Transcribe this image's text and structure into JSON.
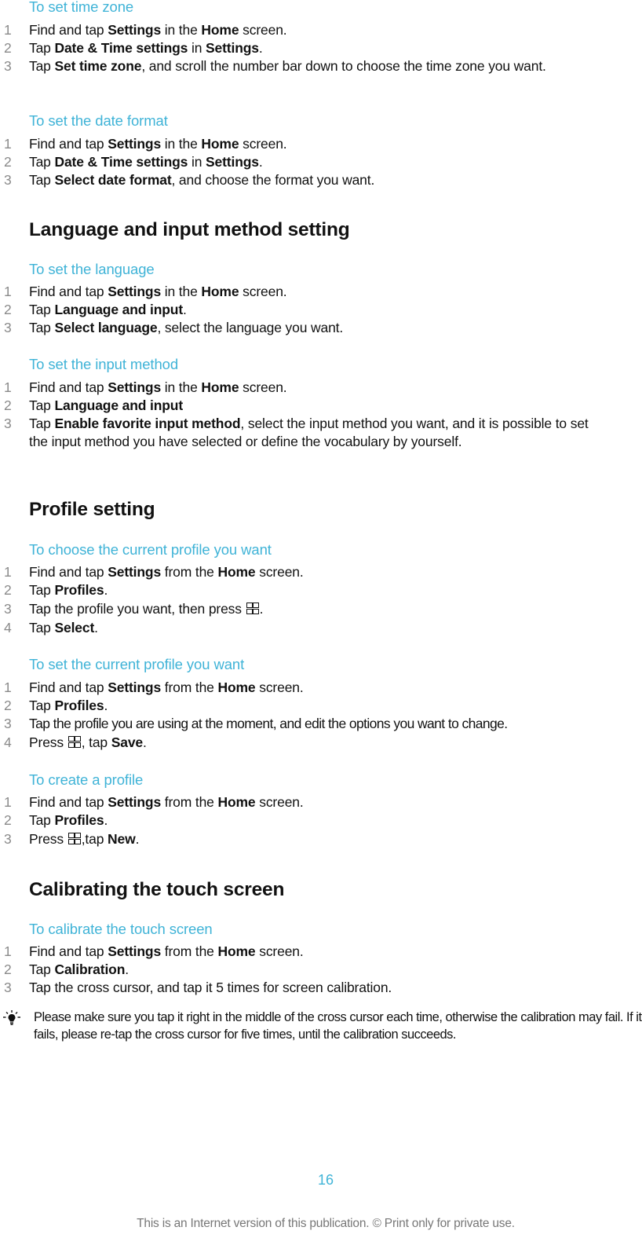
{
  "sections": [
    {
      "id": "time-zone",
      "subheading": "To set time zone",
      "steps": [
        {
          "num": "1",
          "parts": [
            [
              "t",
              "Find and tap "
            ],
            [
              "b",
              "Settings"
            ],
            [
              "t",
              " in the "
            ],
            [
              "b",
              "Home"
            ],
            [
              "t",
              " screen."
            ]
          ]
        },
        {
          "num": "2",
          "parts": [
            [
              "t",
              "Tap "
            ],
            [
              "b",
              "Date & Time settings"
            ],
            [
              "t",
              " in "
            ],
            [
              "b",
              "Settings"
            ],
            [
              "t",
              "."
            ]
          ]
        },
        {
          "num": "3",
          "parts": [
            [
              "t",
              "Tap "
            ],
            [
              "b",
              "Set time zone"
            ],
            [
              "t",
              ", and scroll the number bar down to choose the time zone you want."
            ]
          ]
        }
      ]
    },
    {
      "id": "date-format",
      "subheading": "To set the date format",
      "steps": [
        {
          "num": "1",
          "parts": [
            [
              "t",
              "Find and tap "
            ],
            [
              "b",
              "Settings"
            ],
            [
              "t",
              " in the "
            ],
            [
              "b",
              "Home"
            ],
            [
              "t",
              " screen."
            ]
          ]
        },
        {
          "num": "2",
          "parts": [
            [
              "t",
              "Tap "
            ],
            [
              "b",
              "Date & Time settings"
            ],
            [
              "t",
              " in "
            ],
            [
              "b",
              "Settings"
            ],
            [
              "t",
              "."
            ]
          ]
        },
        {
          "num": "3",
          "parts": [
            [
              "t",
              "Tap "
            ],
            [
              "b",
              "Select date format"
            ],
            [
              "t",
              ", and choose the format you want."
            ]
          ]
        }
      ]
    },
    {
      "id": "language",
      "heading": "Language and input method setting",
      "subheading": "To set the language",
      "steps": [
        {
          "num": "1",
          "parts": [
            [
              "t",
              "Find and tap "
            ],
            [
              "b",
              "Settings"
            ],
            [
              "t",
              " in the "
            ],
            [
              "b",
              "Home"
            ],
            [
              "t",
              " screen."
            ]
          ]
        },
        {
          "num": "2",
          "parts": [
            [
              "t",
              "Tap "
            ],
            [
              "b",
              "Language and input"
            ],
            [
              "t",
              "."
            ]
          ]
        },
        {
          "num": "3",
          "parts": [
            [
              "t",
              "Tap "
            ],
            [
              "b",
              "Select language"
            ],
            [
              "t",
              ", select the language you want."
            ]
          ]
        }
      ]
    },
    {
      "id": "input-method",
      "subheading": "To set the input method",
      "steps": [
        {
          "num": "1",
          "parts": [
            [
              "t",
              "Find and tap "
            ],
            [
              "b",
              "Settings"
            ],
            [
              "t",
              " in the "
            ],
            [
              "b",
              "Home"
            ],
            [
              "t",
              " screen."
            ]
          ]
        },
        {
          "num": "2",
          "parts": [
            [
              "t",
              "Tap "
            ],
            [
              "b",
              "Language and input"
            ]
          ]
        },
        {
          "num": "3",
          "parts": [
            [
              "t",
              "Tap "
            ],
            [
              "b",
              "Enable favorite input method"
            ],
            [
              "t",
              ", select the input method you want, and it is possible to set the input method you have selected or define the vocabulary by yourself."
            ]
          ]
        }
      ]
    },
    {
      "id": "choose-profile",
      "heading": "Profile setting",
      "subheading": "To choose the current profile you want",
      "steps": [
        {
          "num": "1",
          "parts": [
            [
              "t",
              "Find and tap "
            ],
            [
              "b",
              "Settings"
            ],
            [
              "t",
              " from the "
            ],
            [
              "b",
              "Home"
            ],
            [
              "t",
              " screen."
            ]
          ]
        },
        {
          "num": "2",
          "parts": [
            [
              "t",
              "Tap "
            ],
            [
              "b",
              "Profiles"
            ],
            [
              "t",
              "."
            ]
          ]
        },
        {
          "num": "3",
          "parts": [
            [
              "t",
              "Tap the profile you want, then press "
            ],
            [
              "i",
              "menu-icon"
            ],
            [
              "t",
              "."
            ]
          ]
        },
        {
          "num": "4",
          "parts": [
            [
              "t",
              "Tap "
            ],
            [
              "b",
              "Select"
            ],
            [
              "t",
              "."
            ]
          ]
        }
      ]
    },
    {
      "id": "set-profile",
      "subheading": "To set the current profile you want",
      "steps": [
        {
          "num": "1",
          "parts": [
            [
              "t",
              "Find and tap "
            ],
            [
              "b",
              "Settings"
            ],
            [
              "t",
              " from the "
            ],
            [
              "b",
              "Home"
            ],
            [
              "t",
              " screen."
            ]
          ]
        },
        {
          "num": "2",
          "parts": [
            [
              "t",
              "Tap "
            ],
            [
              "b",
              "Profiles"
            ],
            [
              "t",
              "."
            ]
          ]
        },
        {
          "num": "3",
          "tight": true,
          "parts": [
            [
              "t",
              "Tap the profile you are using at the moment, and edit the options you want to change."
            ]
          ]
        },
        {
          "num": "4",
          "parts": [
            [
              "t",
              "Press "
            ],
            [
              "i",
              "menu-icon"
            ],
            [
              "t",
              ", tap "
            ],
            [
              "b",
              "Save"
            ],
            [
              "t",
              "."
            ]
          ]
        }
      ]
    },
    {
      "id": "create-profile",
      "subheading": "To create a profile",
      "steps": [
        {
          "num": "1",
          "parts": [
            [
              "t",
              "Find and tap "
            ],
            [
              "b",
              "Settings"
            ],
            [
              "t",
              " from the "
            ],
            [
              "b",
              "Home"
            ],
            [
              "t",
              " screen."
            ]
          ]
        },
        {
          "num": "2",
          "parts": [
            [
              "t",
              "Tap "
            ],
            [
              "b",
              "Profiles"
            ],
            [
              "t",
              "."
            ]
          ]
        },
        {
          "num": "3",
          "parts": [
            [
              "t",
              "Press "
            ],
            [
              "i",
              "menu-icon"
            ],
            [
              "t",
              ",tap "
            ],
            [
              "b",
              "New"
            ],
            [
              "t",
              "."
            ]
          ]
        }
      ]
    },
    {
      "id": "calibrate",
      "heading": "Calibrating the touch screen",
      "subheading": "To calibrate the touch screen",
      "steps": [
        {
          "num": "1",
          "parts": [
            [
              "t",
              "Find and tap "
            ],
            [
              "b",
              "Settings"
            ],
            [
              "t",
              " from the "
            ],
            [
              "b",
              "Home"
            ],
            [
              "t",
              " screen."
            ]
          ]
        },
        {
          "num": "2",
          "parts": [
            [
              "t",
              "Tap "
            ],
            [
              "b",
              "Calibration"
            ],
            [
              "t",
              "."
            ]
          ]
        },
        {
          "num": "3",
          "parts": [
            [
              "t",
              "Tap the cross cursor, and tap it 5 times for screen calibration."
            ]
          ]
        }
      ]
    }
  ],
  "tip": {
    "icon": "lightbulb-icon",
    "text": "Please make sure you tap it right in the middle of the cross cursor each time, otherwise the calibration may fail. If it fails, please re-tap the cross cursor for five times, until the calibration succeeds."
  },
  "page_number": "16",
  "footer": "This is an Internet version of this publication. © Print only for private use.",
  "colors": {
    "accent": "#3fb3d7",
    "text": "#111111",
    "step_number": "#8a8a8a",
    "footer": "#777777"
  }
}
